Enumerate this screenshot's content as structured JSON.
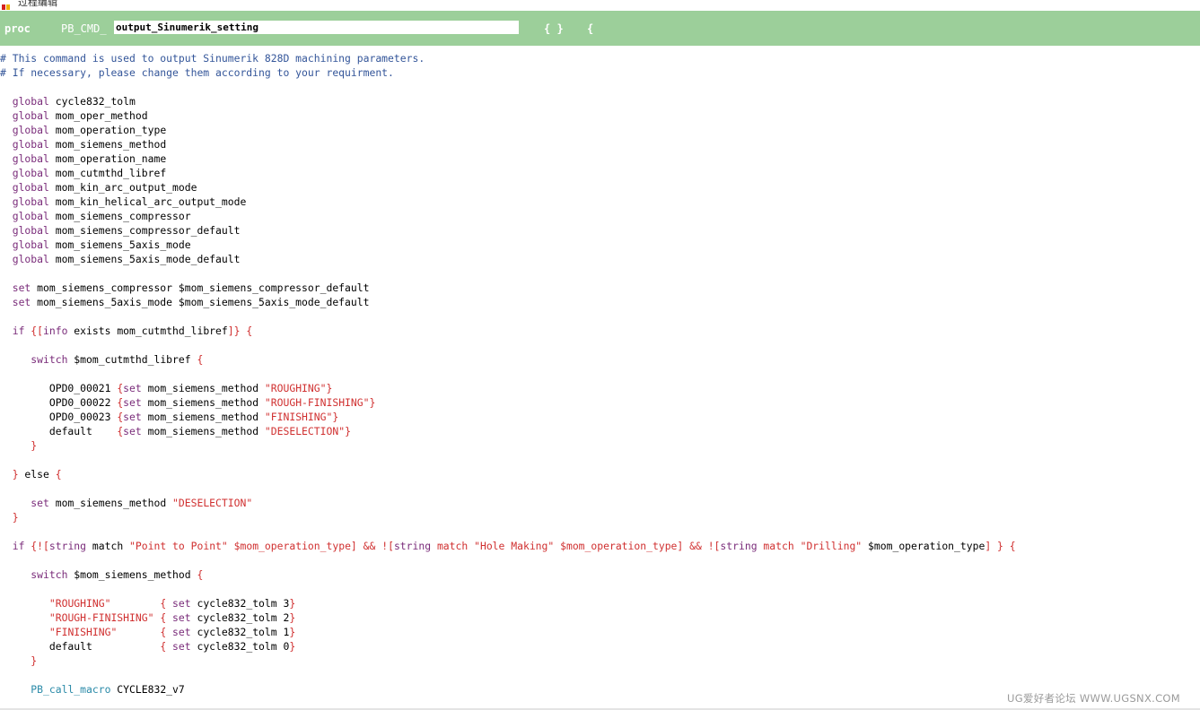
{
  "window": {
    "title_partial": "过程编辑"
  },
  "header": {
    "proc_label": "proc",
    "prefix": "PB_CMD_",
    "name_value": "output_Sinumerik_setting",
    "args": "{ }",
    "open_brace": "{"
  },
  "colors": {
    "header_bg": "#9ccf9a",
    "keyword": "#7a2c7a",
    "string": "#d03030",
    "comment": "#335599",
    "macro": "#2a8aa8"
  },
  "code_lines": [
    [
      [
        "comment",
        "# This command is used to output Sinumerik 828D machining parameters."
      ]
    ],
    [
      [
        "comment",
        "# If necessary, please change them according to your requirment."
      ]
    ],
    [],
    [
      [
        "plain",
        "  "
      ],
      [
        "keyword",
        "global"
      ],
      [
        "var",
        " cycle832_tolm"
      ]
    ],
    [
      [
        "plain",
        "  "
      ],
      [
        "keyword",
        "global"
      ],
      [
        "var",
        " mom_oper_method"
      ]
    ],
    [
      [
        "plain",
        "  "
      ],
      [
        "keyword",
        "global"
      ],
      [
        "var",
        " mom_operation_type"
      ]
    ],
    [
      [
        "plain",
        "  "
      ],
      [
        "keyword",
        "global"
      ],
      [
        "var",
        " mom_siemens_method"
      ]
    ],
    [
      [
        "plain",
        "  "
      ],
      [
        "keyword",
        "global"
      ],
      [
        "var",
        " mom_operation_name"
      ]
    ],
    [
      [
        "plain",
        "  "
      ],
      [
        "keyword",
        "global"
      ],
      [
        "var",
        " mom_cutmthd_libref"
      ]
    ],
    [
      [
        "plain",
        "  "
      ],
      [
        "keyword",
        "global"
      ],
      [
        "var",
        " mom_kin_arc_output_mode"
      ]
    ],
    [
      [
        "plain",
        "  "
      ],
      [
        "keyword",
        "global"
      ],
      [
        "var",
        " mom_kin_helical_arc_output_mode"
      ]
    ],
    [
      [
        "plain",
        "  "
      ],
      [
        "keyword",
        "global"
      ],
      [
        "var",
        " mom_siemens_compressor"
      ]
    ],
    [
      [
        "plain",
        "  "
      ],
      [
        "keyword",
        "global"
      ],
      [
        "var",
        " mom_siemens_compressor_default"
      ]
    ],
    [
      [
        "plain",
        "  "
      ],
      [
        "keyword",
        "global"
      ],
      [
        "var",
        " mom_siemens_5axis_mode"
      ]
    ],
    [
      [
        "plain",
        "  "
      ],
      [
        "keyword",
        "global"
      ],
      [
        "var",
        " mom_siemens_5axis_mode_default"
      ]
    ],
    [],
    [
      [
        "plain",
        "  "
      ],
      [
        "keyword",
        "set"
      ],
      [
        "var",
        " mom_siemens_compressor $mom_siemens_compressor_default"
      ]
    ],
    [
      [
        "plain",
        "  "
      ],
      [
        "keyword",
        "set"
      ],
      [
        "var",
        " mom_siemens_5axis_mode $mom_siemens_5axis_mode_default"
      ]
    ],
    [],
    [
      [
        "plain",
        "  "
      ],
      [
        "keyword",
        "if"
      ],
      [
        "brace",
        " {["
      ],
      [
        "keyword",
        "info"
      ],
      [
        "var",
        " exists mom_cutmthd_libref"
      ],
      [
        "brace",
        "]} {"
      ]
    ],
    [],
    [
      [
        "plain",
        "     "
      ],
      [
        "keyword",
        "switch"
      ],
      [
        "var",
        " $mom_cutmthd_libref "
      ],
      [
        "brace",
        "{"
      ]
    ],
    [],
    [
      [
        "plain",
        "        OPD0_00021 "
      ],
      [
        "brace",
        "{"
      ],
      [
        "keyword",
        "set"
      ],
      [
        "var",
        " mom_siemens_method "
      ],
      [
        "string",
        "\"ROUGHING\""
      ],
      [
        "brace",
        "}"
      ]
    ],
    [
      [
        "plain",
        "        OPD0_00022 "
      ],
      [
        "brace",
        "{"
      ],
      [
        "keyword",
        "set"
      ],
      [
        "var",
        " mom_siemens_method "
      ],
      [
        "string",
        "\"ROUGH-FINISHING\""
      ],
      [
        "brace",
        "}"
      ]
    ],
    [
      [
        "plain",
        "        OPD0_00023 "
      ],
      [
        "brace",
        "{"
      ],
      [
        "keyword",
        "set"
      ],
      [
        "var",
        " mom_siemens_method "
      ],
      [
        "string",
        "\"FINISHING\""
      ],
      [
        "brace",
        "}"
      ]
    ],
    [
      [
        "plain",
        "        default    "
      ],
      [
        "brace",
        "{"
      ],
      [
        "keyword",
        "set"
      ],
      [
        "var",
        " mom_siemens_method "
      ],
      [
        "string",
        "\"DESELECTION\""
      ],
      [
        "brace",
        "}"
      ]
    ],
    [
      [
        "plain",
        "     "
      ],
      [
        "brace",
        "}"
      ]
    ],
    [],
    [
      [
        "plain",
        "  "
      ],
      [
        "brace",
        "}"
      ],
      [
        "var",
        " else "
      ],
      [
        "brace",
        "{"
      ]
    ],
    [],
    [
      [
        "plain",
        "     "
      ],
      [
        "keyword",
        "set"
      ],
      [
        "var",
        " mom_siemens_method "
      ],
      [
        "string",
        "\"DESELECTION\""
      ]
    ],
    [
      [
        "plain",
        "  "
      ],
      [
        "brace",
        "}"
      ]
    ],
    [],
    [
      [
        "plain",
        "  "
      ],
      [
        "keyword",
        "if"
      ],
      [
        "brace",
        " {!["
      ],
      [
        "keyword",
        "string"
      ],
      [
        "var",
        " match "
      ],
      [
        "string",
        "\"Point to Point\" $mom_operation_type] && !["
      ],
      [
        "keyword",
        "string"
      ],
      [
        "string",
        " match \"Hole Making\" $mom_operation_type] && !["
      ],
      [
        "keyword",
        "string"
      ],
      [
        "string",
        " match \"Drilling\" "
      ],
      [
        "var",
        "$mom_operation_type"
      ],
      [
        "brace",
        "] } {"
      ]
    ],
    [],
    [
      [
        "plain",
        "     "
      ],
      [
        "keyword",
        "switch"
      ],
      [
        "var",
        " $mom_siemens_method "
      ],
      [
        "brace",
        "{"
      ]
    ],
    [],
    [
      [
        "plain",
        "        "
      ],
      [
        "string",
        "\"ROUGHING\"        "
      ],
      [
        "brace",
        "{ "
      ],
      [
        "keyword",
        "set"
      ],
      [
        "var",
        " cycle832_tolm 3"
      ],
      [
        "brace",
        "}"
      ]
    ],
    [
      [
        "plain",
        "        "
      ],
      [
        "string",
        "\"ROUGH-FINISHING\" "
      ],
      [
        "brace",
        "{ "
      ],
      [
        "keyword",
        "set"
      ],
      [
        "var",
        " cycle832_tolm 2"
      ],
      [
        "brace",
        "}"
      ]
    ],
    [
      [
        "plain",
        "        "
      ],
      [
        "string",
        "\"FINISHING\"       "
      ],
      [
        "brace",
        "{ "
      ],
      [
        "keyword",
        "set"
      ],
      [
        "var",
        " cycle832_tolm 1"
      ],
      [
        "brace",
        "}"
      ]
    ],
    [
      [
        "plain",
        "        default           "
      ],
      [
        "brace",
        "{ "
      ],
      [
        "keyword",
        "set"
      ],
      [
        "var",
        " cycle832_tolm 0"
      ],
      [
        "brace",
        "}"
      ]
    ],
    [
      [
        "plain",
        "     "
      ],
      [
        "brace",
        "}"
      ]
    ],
    [],
    [
      [
        "plain",
        "     "
      ],
      [
        "macro",
        "PB_call_macro"
      ],
      [
        "var",
        " CYCLE832_v7"
      ]
    ]
  ],
  "watermark": "UG爱好者论坛 WWW.UGSNX.COM"
}
